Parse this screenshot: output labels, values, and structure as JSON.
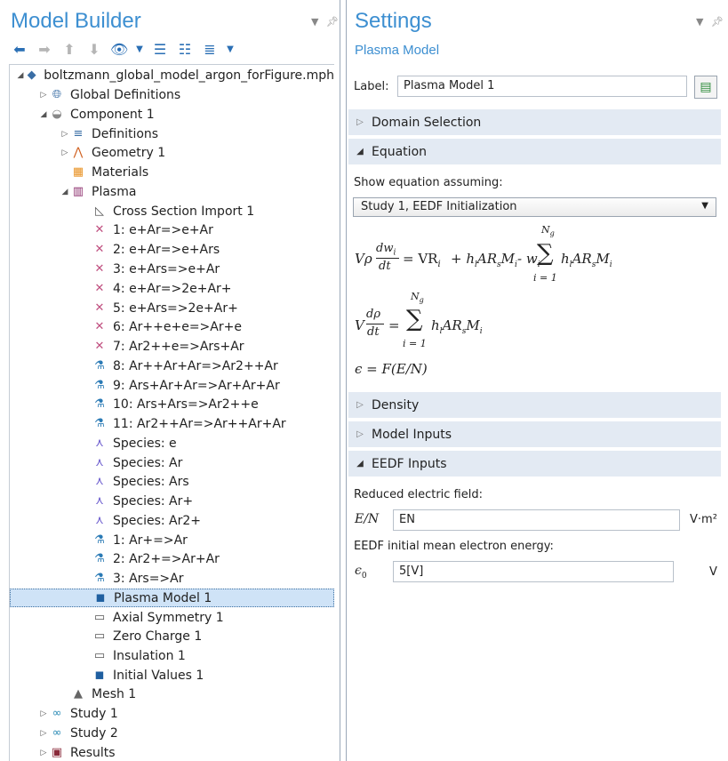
{
  "model_builder": {
    "title": "Model Builder",
    "tree": [
      {
        "label": "boltzmann_global_model_argon_forFigure.mph",
        "icon": "file-model-icon",
        "expander": "open"
      },
      {
        "label": "Global Definitions",
        "icon": "globe-icon",
        "expander": "closed"
      },
      {
        "label": "Component 1",
        "icon": "component-icon",
        "expander": "open"
      },
      {
        "label": "Definitions",
        "icon": "definitions-icon",
        "expander": "closed"
      },
      {
        "label": "Geometry 1",
        "icon": "geometry-icon",
        "expander": "closed"
      },
      {
        "label": "Materials",
        "icon": "materials-icon",
        "expander": ""
      },
      {
        "label": "Plasma",
        "icon": "plasma-icon",
        "expander": "open"
      },
      {
        "label": "Cross Section Import 1",
        "icon": "cross-section-icon",
        "expander": ""
      },
      {
        "label": "1: e+Ar=>e+Ar",
        "icon": "reaction-icon",
        "expander": ""
      },
      {
        "label": "2: e+Ar=>e+Ars",
        "icon": "reaction-icon",
        "expander": ""
      },
      {
        "label": "3: e+Ars=>e+Ar",
        "icon": "reaction-icon",
        "expander": ""
      },
      {
        "label": "4: e+Ar=>2e+Ar+",
        "icon": "reaction-icon",
        "expander": ""
      },
      {
        "label": "5: e+Ars=>2e+Ar+",
        "icon": "reaction-icon",
        "expander": ""
      },
      {
        "label": "6: Ar++e+e=>Ar+e",
        "icon": "reaction-icon",
        "expander": ""
      },
      {
        "label": "7: Ar2++e=>Ars+Ar",
        "icon": "reaction-icon",
        "expander": ""
      },
      {
        "label": "8: Ar++Ar+Ar=>Ar2++Ar",
        "icon": "flask-icon",
        "expander": ""
      },
      {
        "label": "9: Ars+Ar+Ar=>Ar+Ar+Ar",
        "icon": "flask-icon",
        "expander": ""
      },
      {
        "label": "10: Ars+Ars=>Ar2++e",
        "icon": "flask-icon",
        "expander": ""
      },
      {
        "label": "11: Ar2++Ar=>Ar++Ar+Ar",
        "icon": "flask-icon",
        "expander": ""
      },
      {
        "label": "Species: e",
        "icon": "species-icon",
        "expander": ""
      },
      {
        "label": "Species: Ar",
        "icon": "species-icon",
        "expander": ""
      },
      {
        "label": "Species: Ars",
        "icon": "species-icon",
        "expander": ""
      },
      {
        "label": "Species: Ar+",
        "icon": "species-icon",
        "expander": ""
      },
      {
        "label": "Species: Ar2+",
        "icon": "species-icon",
        "expander": ""
      },
      {
        "label": "1: Ar+=>Ar",
        "icon": "flask-icon",
        "expander": ""
      },
      {
        "label": "2: Ar2+=>Ar+Ar",
        "icon": "flask-icon",
        "expander": ""
      },
      {
        "label": "3: Ars=>Ar",
        "icon": "flask-icon",
        "expander": ""
      },
      {
        "label": "Plasma Model 1",
        "icon": "domain-node-icon",
        "expander": "",
        "selected": true
      },
      {
        "label": "Axial Symmetry 1",
        "icon": "boundary-node-icon",
        "expander": ""
      },
      {
        "label": "Zero Charge 1",
        "icon": "boundary-node-icon",
        "expander": ""
      },
      {
        "label": "Insulation 1",
        "icon": "boundary-node-icon",
        "expander": ""
      },
      {
        "label": "Initial Values 1",
        "icon": "domain-node-icon",
        "expander": ""
      },
      {
        "label": "Mesh 1",
        "icon": "mesh-icon",
        "expander": ""
      },
      {
        "label": "Study 1",
        "icon": "study-icon",
        "expander": "closed"
      },
      {
        "label": "Study 2",
        "icon": "study-icon",
        "expander": "closed"
      },
      {
        "label": "Results",
        "icon": "results-icon",
        "expander": "closed"
      }
    ]
  },
  "settings": {
    "title": "Settings",
    "subtitle": "Plasma Model",
    "label_caption": "Label:",
    "label_value": "Plasma Model 1",
    "sections": {
      "domain_selection": "Domain Selection",
      "equation": "Equation",
      "density": "Density",
      "model_inputs": "Model Inputs",
      "eedf_inputs": "EEDF Inputs"
    },
    "show_equation_caption": "Show equation assuming:",
    "show_equation_value": "Study 1, EEDF Initialization",
    "equations": {
      "eq1_lhs_prefix": "Vρ",
      "eq1_frac_num": "dw",
      "eq1_frac_num_sub": "i",
      "eq1_frac_den": "dt",
      "eq1_rhs": "= VR",
      "eq1_rhs_sub": "i",
      "eq1_term2": "+ h",
      "eq1_term2_rest": "AR",
      "eq1_term2_M": "M",
      "eq1_term3": "- w",
      "eq1_sum_top": "N",
      "eq1_sum_top_sub": "g",
      "eq1_sum_bottom": "i = 1",
      "eq2_prefix": "V",
      "eq2_frac_num": "dρ",
      "eq2_frac_den": "dt",
      "eq2_eq": "=",
      "eq2_sum_top": "N",
      "eq2_sum_top_sub": "g",
      "eq2_sum_bottom": "i = 1",
      "eq3": "ϵ = F(E/N)"
    },
    "reduced_field_caption": "Reduced electric field:",
    "reduced_field_symbol": "E/N",
    "reduced_field_value": "EN",
    "reduced_field_unit": "V·m²",
    "eedf_energy_caption": "EEDF initial mean electron energy:",
    "eedf_energy_symbol": "ϵ",
    "eedf_energy_symbol_sub": "0",
    "eedf_energy_value": "5[V]",
    "eedf_energy_unit": "V"
  },
  "colors": {
    "title": "#3d8fd1",
    "section_bg": "#e3eaf3",
    "selection": "#cfe3f7"
  }
}
